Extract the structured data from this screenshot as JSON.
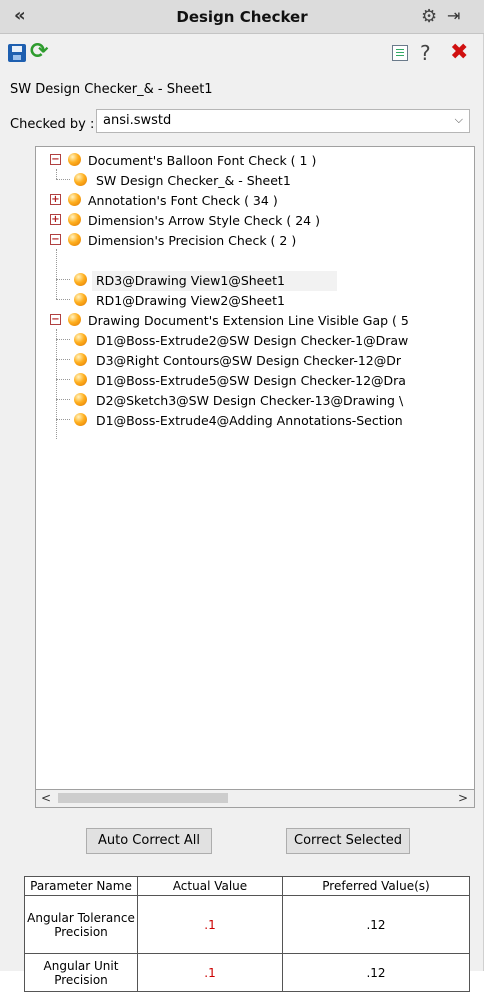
{
  "titlebar": {
    "collapse": "«",
    "title": "Design Checker",
    "gear": "⚙",
    "pin": "⇥"
  },
  "toolbar": {
    "icons": {
      "save": "save-icon",
      "refresh": "refresh-icon",
      "report": "report-list-icon",
      "help": "help-icon",
      "close": "close-icon"
    },
    "refresh_glyph": "⟳",
    "help_glyph": "?",
    "close_glyph": "✖"
  },
  "doc_name": "SW Design Checker_& - Sheet1",
  "checked_by": {
    "label": "Checked by :",
    "value": "ansi.swstd",
    "arrow": "⌵"
  },
  "tree": {
    "items": [
      {
        "label": "Document's Balloon Font Check ( 1 )",
        "expander": "−"
      },
      {
        "label": "SW Design Checker_& - Sheet1"
      },
      {
        "label": "Annotation's Font Check ( 34 )",
        "expander": "+"
      },
      {
        "label": "Dimension's Arrow Style Check ( 24 )",
        "expander": "+"
      },
      {
        "label": "Dimension's Precision Check ( 2 )",
        "expander": "−"
      },
      {
        "label": "RD3@Drawing View1@Sheet1"
      },
      {
        "label": "RD1@Drawing View2@Sheet1"
      },
      {
        "label": "Drawing Document's Extension Line Visible Gap ( 5",
        "expander": "−"
      },
      {
        "label": "D1@Boss-Extrude2@SW Design Checker-1@Draw"
      },
      {
        "label": "D3@Right Contours@SW Design Checker-12@Dr"
      },
      {
        "label": "D1@Boss-Extrude5@SW Design Checker-12@Dra"
      },
      {
        "label": "D2@Sketch3@SW Design Checker-13@Drawing \\"
      },
      {
        "label": "D1@Boss-Extrude4@Adding Annotations-Section"
      }
    ]
  },
  "scroll": {
    "left": "<",
    "right": ">"
  },
  "buttons": {
    "auto_correct": "Auto Correct All",
    "correct_selected": "Correct Selected"
  },
  "param_table": {
    "headers": [
      "Parameter Name",
      "Actual Value",
      "Preferred Value(s)"
    ],
    "rows": [
      {
        "name": "Angular Tolerance Precision",
        "actual": ".1",
        "preferred": ".12"
      },
      {
        "name": "Angular Unit Precision",
        "actual": ".1",
        "preferred": ".12"
      }
    ]
  },
  "colors": {
    "error_value": "#cc0000",
    "bulb": "#ffb020",
    "close": "#d01010",
    "refresh": "#2e9c2e"
  }
}
